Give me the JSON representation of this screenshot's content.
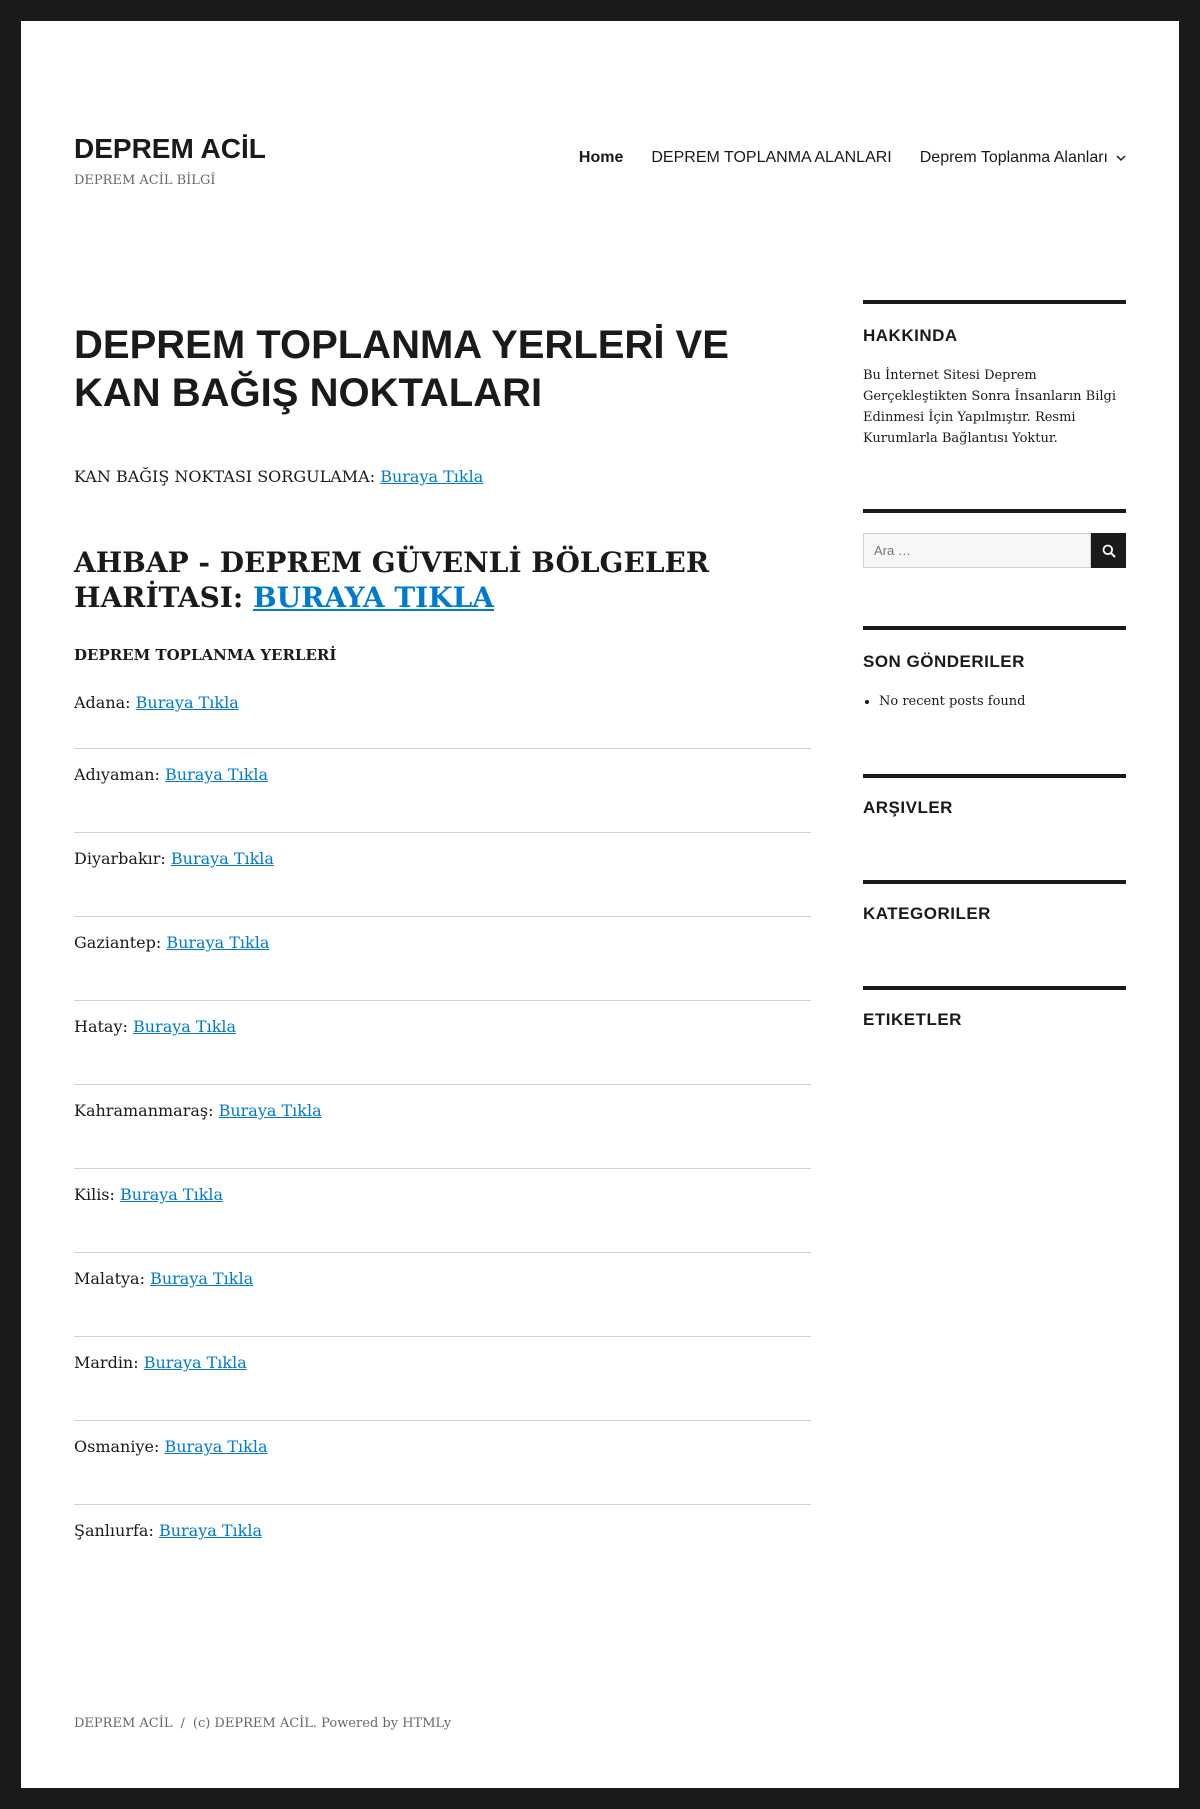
{
  "header": {
    "site_title": "DEPREM ACİL",
    "site_description": "DEPREM ACİL BİLGİ",
    "nav": [
      {
        "label": "Home"
      },
      {
        "label": "DEPREM TOPLANMA ALANLARI"
      },
      {
        "label": "Deprem Toplanma Alanları"
      }
    ]
  },
  "main": {
    "title": "DEPREM TOPLANMA YERLERİ VE KAN BAĞIŞ NOKTALARI",
    "kan_label": "KAN BAĞIŞ NOKTASI SORGULAMA:",
    "kan_link": "Buraya Tıkla",
    "ahbap_label": "AHBAP - DEPREM GÜVENLİ BÖLGELER HARİTASI:",
    "ahbap_link": "BURAYA TIKLA",
    "toplanma_heading": "DEPREM TOPLANMA YERLERİ",
    "cities": [
      {
        "name": "Adana:",
        "link": "Buraya Tıkla"
      },
      {
        "name": "Adıyaman:",
        "link": "Buraya Tıkla"
      },
      {
        "name": "Diyarbakır:",
        "link": "Buraya Tıkla"
      },
      {
        "name": "Gaziantep:",
        "link": "Buraya Tıkla"
      },
      {
        "name": "Hatay:",
        "link": "Buraya Tıkla"
      },
      {
        "name": "Kahramanmaraş:",
        "link": "Buraya Tıkla"
      },
      {
        "name": "Kilis:",
        "link": "Buraya Tıkla"
      },
      {
        "name": "Malatya:",
        "link": "Buraya Tıkla"
      },
      {
        "name": "Mardin:",
        "link": "Buraya Tıkla"
      },
      {
        "name": "Osmaniye:",
        "link": "Buraya Tıkla"
      },
      {
        "name": "Şanlıurfa:",
        "link": "Buraya Tıkla"
      }
    ]
  },
  "sidebar": {
    "about_title": "HAKKINDA",
    "about_text": "Bu İnternet Sitesi Deprem Gerçekleştikten Sonra İnsanların Bilgi Edinmesi İçin Yapılmıştır. Resmi Kurumlarla Bağlantısı Yoktur.",
    "search_placeholder": "Ara …",
    "recent_title": "SON GÖNDERILER",
    "recent_empty": "No recent posts found",
    "archives_title": "ARŞIVLER",
    "categories_title": "KATEGORILER",
    "tags_title": "ETIKETLER"
  },
  "footer": {
    "site_name": "DEPREM ACİL",
    "separator": "/",
    "copyright": "(c) DEPREM ACİL. Powered by HTMLy"
  },
  "colors": {
    "link": "#007acc",
    "text": "#1a1a1a",
    "frame": "#1a1a1a"
  },
  "icons": {
    "search_button": "search-icon",
    "nav_dropdown": "chevron-down-icon"
  }
}
